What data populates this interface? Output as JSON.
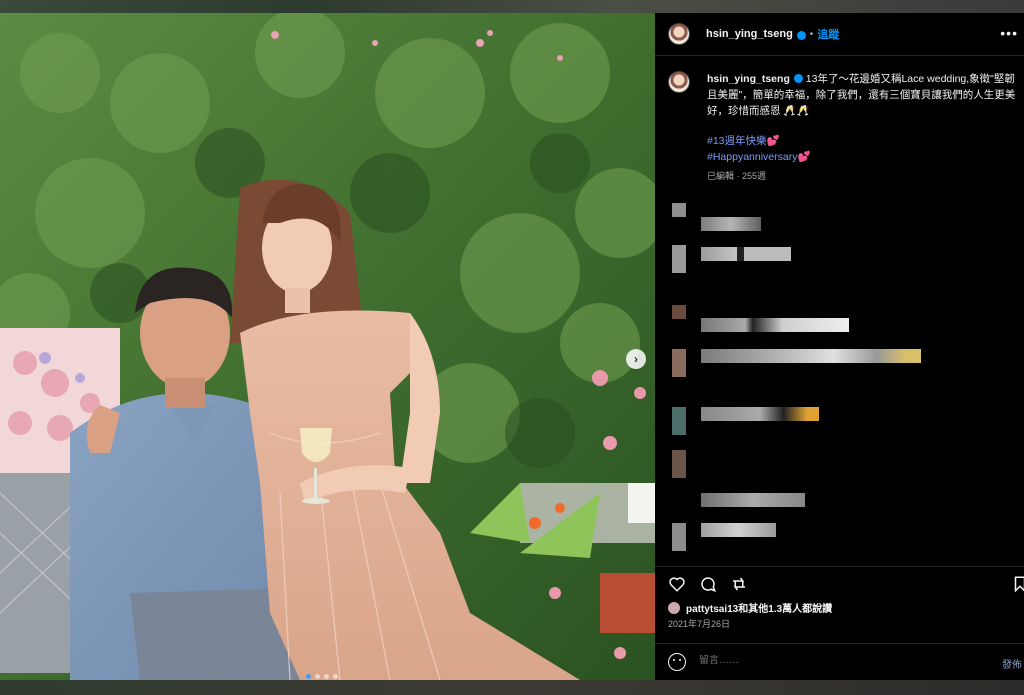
{
  "post": {
    "username": "hsin_ying_tseng",
    "follow_label": "追蹤",
    "separator": "•",
    "more_label": "•••"
  },
  "caption": {
    "username": "hsin_ying_tseng",
    "text": " 13年了～花邊婚又稱Lace wedding,象徵\"堅韌且美麗\"，簡單的幸福，除了我們，還有三個寶貝讓我們的人生更美好，珍惜而感恩 🥂🥂",
    "hashtags": [
      "#13週年快樂",
      "#Happyanniversary"
    ],
    "heart": "💕",
    "meta": "已編輯 · 255週"
  },
  "engagement": {
    "liked_by": "pattytsai13和其他1.3萬人都說讚",
    "date": "2021年7月26日"
  },
  "composer": {
    "placeholder": "留言……",
    "post_label": "發佈"
  },
  "carousel": {
    "slides": 4,
    "active_index": 0,
    "next_label": "›"
  },
  "colors": {
    "accent": "#0095f6",
    "hashtag": "#7c9cff",
    "panel_bg": "#000000"
  },
  "icons": [
    "heart-icon",
    "comment-icon",
    "share-icon",
    "bookmark-icon",
    "emoji-icon",
    "verified-icon",
    "more-icon"
  ]
}
